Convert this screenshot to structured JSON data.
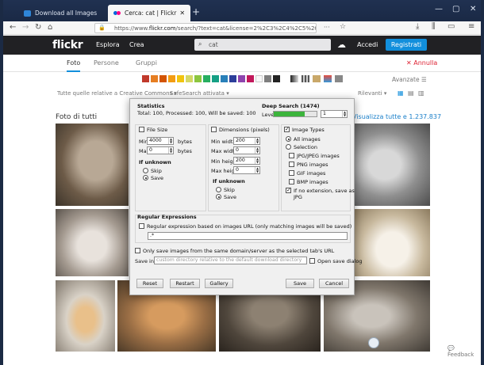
{
  "browser": {
    "tabs": [
      {
        "label": "Download all Images – Comp…",
        "close": "✕"
      },
      {
        "label": "Cerca: cat | Flickr",
        "close": "✕"
      }
    ],
    "new_tab": "+",
    "window_controls": {
      "minimize": "—",
      "maximize": "▢",
      "close": "✕"
    },
    "nav": {
      "back": "←",
      "forward": "→",
      "reload": "↻",
      "home": "⌂"
    },
    "url": {
      "prefix": "https://www.",
      "domain": "flickr.com",
      "rest": "/search/?text=cat&license=2%2C3%2C4%2C5%2C6%2C9"
    },
    "url_actions": {
      "more": "···",
      "bookmark": "☆"
    }
  },
  "flickr": {
    "logo": "flickr",
    "nav": {
      "explore": "Esplora",
      "create": "Crea"
    },
    "search_value": "cat",
    "login": "Accedi",
    "signup": "Registrati",
    "tabs": {
      "photos": "Foto",
      "people": "Persone",
      "groups": "Gruppi"
    },
    "cancel": "Annulla",
    "advanced": "Avanzate",
    "filters": {
      "license": "Tutte quelle relative a Creative Commons ▾",
      "safesearch": "SafeSearch attivata ▾",
      "relevant": "Rilevanti ▾"
    },
    "section_title": "Foto di tutti",
    "view_all": "Visualizza tutte e 1.237.837",
    "feedback": "Feedback",
    "colors": [
      "#c0392b",
      "#e67e22",
      "#d35400",
      "#f39c12",
      "#f1c40f",
      "#d4d866",
      "#8cc63f",
      "#27ae60",
      "#16a085",
      "#2980b9",
      "#2c3e9a",
      "#8e44ad",
      "#c2185b",
      "#f8f8f8",
      "#7f7f7f",
      "#222222"
    ]
  },
  "dialog": {
    "statistics_title": "Statistics",
    "statistics_text": "Total: 100, Processed: 100, Will be saved: 100",
    "deep_search_title": "Deep Search (1474)",
    "level_label": "Level",
    "level_value": "1",
    "level_progress": 0.72,
    "file_size": {
      "title": "File Size",
      "min_label": "Min",
      "min_value": "4000",
      "min_unit": "bytes",
      "max_label": "Max",
      "max_value": "0",
      "max_unit": "bytes",
      "unknown_title": "If unknown",
      "skip": "Skip",
      "save": "Save"
    },
    "dimensions": {
      "title": "Dimensions (pixels)",
      "min_width_label": "Min width",
      "min_width": "200",
      "max_width_label": "Max width",
      "max_width": "0",
      "min_height_label": "Min height",
      "min_height": "200",
      "max_height_label": "Max height",
      "max_height": "0",
      "unknown_title": "If unknown",
      "skip": "Skip",
      "save": "Save"
    },
    "image_types": {
      "title": "Image Types",
      "all": "All images",
      "selection": "Selection",
      "jpg": "JPG/JPEG images",
      "png": "PNG images",
      "gif": "GIF images",
      "bmp": "BMP images",
      "noext": "If no extension, save as",
      "noext2": "JPG"
    },
    "regex": {
      "title": "Regular Expressions",
      "checkbox": "Regular expression based on images URL (only matching images will be saved)",
      "value": ".*"
    },
    "same_domain": "Only save images from the same domain/server as the selected tab's URL",
    "save_in_label": "Save in",
    "save_in_placeholder": "custom directory relative to the default download directory",
    "open_save_dialog": "Open save dialog",
    "buttons": {
      "reset": "Reset",
      "restart": "Restart",
      "gallery": "Gallery",
      "save": "Save",
      "cancel": "Cancel"
    }
  }
}
